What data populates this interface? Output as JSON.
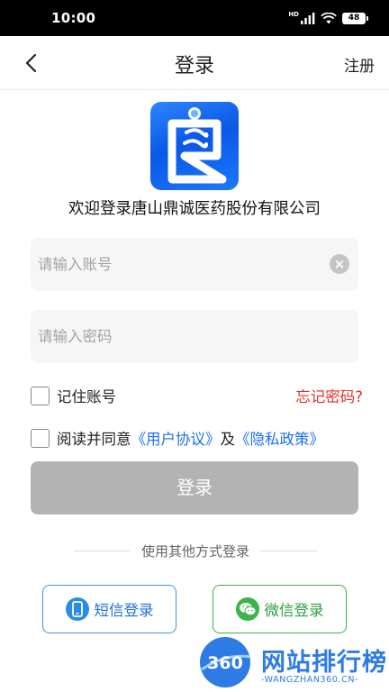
{
  "status_bar": {
    "time": "10:00",
    "network": "HD",
    "battery": "48"
  },
  "header": {
    "title": "登录",
    "register_label": "注册"
  },
  "welcome_text": "欢迎登录唐山鼎诚医药股份有限公司",
  "account": {
    "placeholder": "请输入账号",
    "value": ""
  },
  "password": {
    "placeholder": "请输入密码",
    "value": ""
  },
  "remember": {
    "label": "记住账号",
    "checked": false
  },
  "forgot_label": "忘记密码?",
  "agreement": {
    "prefix": "阅读并同意",
    "user_agreement": "《用户协议》",
    "and": "及",
    "privacy_policy": "《隐私政策》",
    "checked": false
  },
  "login_button": "登录",
  "divider_text": "使用其他方式登录",
  "sms_login": "短信登录",
  "wechat_login": "微信登录",
  "watermark": {
    "title": "网站排行榜",
    "badge": "360",
    "subtitle": "-WANGZHAN360.CN-"
  },
  "colors": {
    "accent_blue": "#1a6ff0",
    "forgot_red": "#e0302d",
    "login_disabled": "#b3b3b3",
    "wechat_green": "#36b24a"
  },
  "icons": [
    "back-chevron-icon",
    "clear-icon",
    "phone-icon",
    "wechat-icon",
    "signal-icon",
    "wifi-icon",
    "battery-icon"
  ]
}
